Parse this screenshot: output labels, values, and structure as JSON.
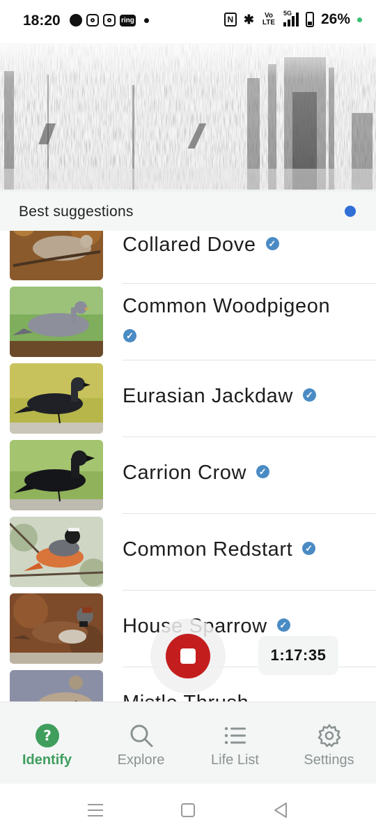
{
  "status_bar": {
    "time": "18:20",
    "battery": "26%",
    "volte": "Vo LTE",
    "network": "5G"
  },
  "spectrogram": {
    "label": "spectrogram"
  },
  "suggestions": {
    "title": "Best suggestions"
  },
  "species": [
    {
      "name": "Collared Dove"
    },
    {
      "name": "Common Woodpigeon"
    },
    {
      "name": "Eurasian Jackdaw"
    },
    {
      "name": "Carrion Crow"
    },
    {
      "name": "Common Redstart"
    },
    {
      "name": "House Sparrow"
    },
    {
      "name": "Mistle Thrush"
    }
  ],
  "recording": {
    "timer": "1:17:35"
  },
  "nav": {
    "identify": "Identify",
    "explore": "Explore",
    "life_list": "Life List",
    "settings": "Settings"
  },
  "colors": {
    "accent_green": "#3f9e5c",
    "record_red": "#c41d1d",
    "verified_blue": "#4a8bc4",
    "status_dot_blue": "#2f6fd6"
  }
}
